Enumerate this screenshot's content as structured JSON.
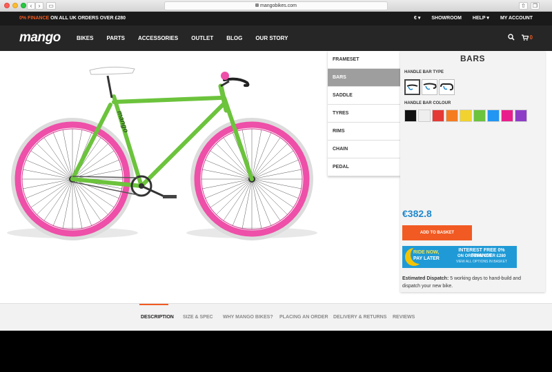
{
  "browser": {
    "url": "mangobikes.com"
  },
  "promo": {
    "finance_highlight": "0% FINANCE",
    "finance_rest": " ON ALL UK ORDERS OVER £280",
    "currency": "€ ▾",
    "showroom": "SHOWROOM",
    "help": "HELP ▾",
    "account": "MY ACCOUNT"
  },
  "nav": {
    "logo": "mango",
    "items": [
      "BIKES",
      "PARTS",
      "ACCESSORIES",
      "OUTLET",
      "BLOG",
      "OUR STORY"
    ],
    "cart_count": "0"
  },
  "customizer": {
    "menu": [
      "FRAMESET",
      "BARS",
      "SADDLE",
      "TYRES",
      "RIMS",
      "CHAIN",
      "PEDAL"
    ],
    "active_index": 1,
    "panel_title": "BARS",
    "handle_type_label": "HANDLE BAR TYPE",
    "handle_colour_label": "HANDLE BAR COLOUR",
    "colours": [
      "#111111",
      "#eeeeee",
      "#e53935",
      "#f57c1f",
      "#f2d22e",
      "#6cc33c",
      "#2196f3",
      "#e91e8c",
      "#8e3cc8"
    ]
  },
  "product": {
    "price": "€382.8",
    "add_to_basket": "ADD TO BASKET",
    "finance": {
      "line1": "RIDE NOW,",
      "line2": "PAY LATER",
      "headline": "INTEREST FREE 0% FINANCE",
      "sub": "ON ORDERS OVER £280",
      "link": "VIEW ALL OPTIONS IN BASKET"
    },
    "dispatch_label": "Estimated Dispatch:",
    "dispatch_text": " 5 working days to hand-build and dispatch your new bike."
  },
  "bike_brand_text": "mango",
  "tabs": [
    "DESCRIPTION",
    "SIZE & SPEC",
    "WHY MANGO BIKES?",
    "PLACING AN ORDER",
    "DELIVERY & RETURNS",
    "REVIEWS"
  ],
  "colors": {
    "accent": "#f15a22",
    "price_blue": "#1f88cc",
    "frame_green": "#6cc33c",
    "rim_pink": "#ee4fa8"
  }
}
